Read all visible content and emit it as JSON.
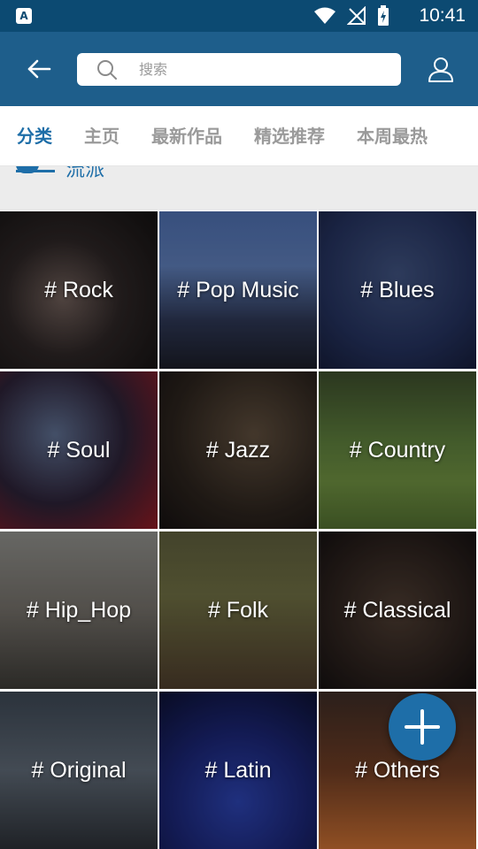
{
  "status_bar": {
    "notification_icon": "app-notification-icon",
    "notification_glyph": "A",
    "time": "10:41"
  },
  "app_bar": {
    "search": {
      "placeholder": "搜索"
    }
  },
  "tabs": [
    {
      "label": "分类",
      "active": true
    },
    {
      "label": "主页",
      "active": false
    },
    {
      "label": "最新作品",
      "active": false
    },
    {
      "label": "精选推荐",
      "active": false
    },
    {
      "label": "本周最热",
      "active": false
    }
  ],
  "section": {
    "title": "流派"
  },
  "genres": [
    {
      "label": "# Rock"
    },
    {
      "label": "# Pop Music"
    },
    {
      "label": "# Blues"
    },
    {
      "label": "# Soul"
    },
    {
      "label": "# Jazz"
    },
    {
      "label": "# Country"
    },
    {
      "label": "# Hip_Hop"
    },
    {
      "label": "# Folk"
    },
    {
      "label": "# Classical"
    },
    {
      "label": "# Original"
    },
    {
      "label": "# Latin"
    },
    {
      "label": "# Others"
    }
  ],
  "colors": {
    "status_bar": "#0c4a72",
    "app_bar": "#1e5e8b",
    "accent": "#1e6ea8",
    "inactive_tab": "#9a9a9a"
  }
}
